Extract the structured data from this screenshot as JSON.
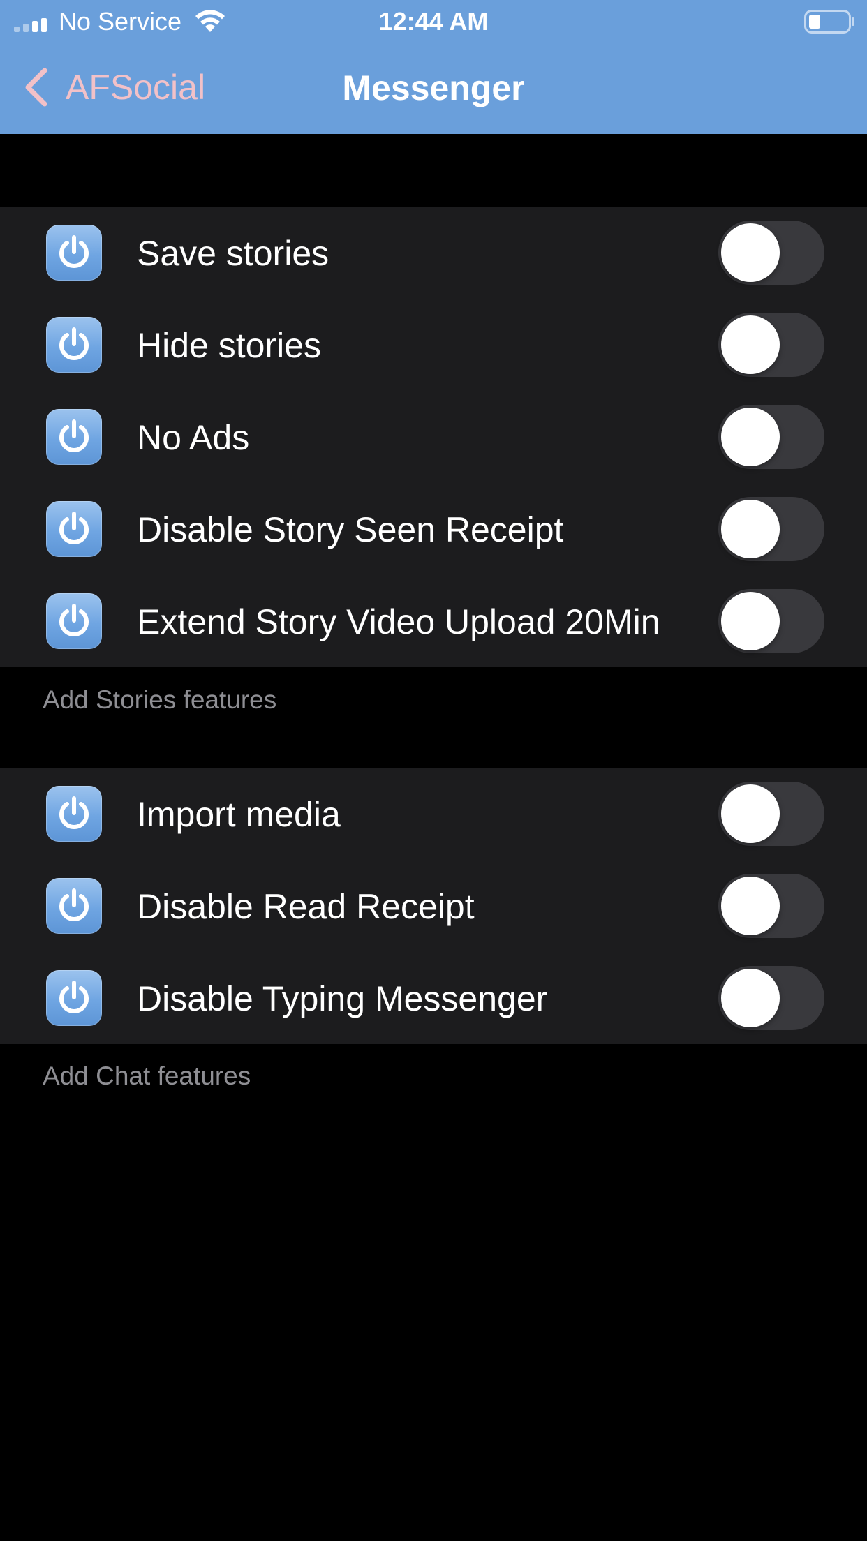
{
  "status_bar": {
    "carrier": "No Service",
    "time": "12:44 AM",
    "signal_icon": "signal-bars-icon",
    "wifi_icon": "wifi-icon",
    "battery_icon": "battery-icon"
  },
  "nav": {
    "back_label": "AFSocial",
    "title": "Messenger",
    "back_icon": "chevron-left-icon"
  },
  "colors": {
    "header_background": "#6a9fdb",
    "back_label": "#f2c1c8",
    "page_background": "#000000",
    "cell_background": "#1c1c1e",
    "toggle_off_track": "#39393d",
    "footer_text": "#8e8e93",
    "icon_tile": "#6fa5e2"
  },
  "sections": [
    {
      "footer": "Add Stories features",
      "rows": [
        {
          "label": "Save stories",
          "icon": "power-icon",
          "enabled": false
        },
        {
          "label": "Hide stories",
          "icon": "power-icon",
          "enabled": false
        },
        {
          "label": "No Ads",
          "icon": "power-icon",
          "enabled": false
        },
        {
          "label": "Disable Story Seen Receipt",
          "icon": "power-icon",
          "enabled": false
        },
        {
          "label": "Extend Story Video Upload 20Min",
          "icon": "power-icon",
          "enabled": false
        }
      ]
    },
    {
      "footer": "Add Chat features",
      "rows": [
        {
          "label": "Import media",
          "icon": "power-icon",
          "enabled": false
        },
        {
          "label": "Disable Read Receipt",
          "icon": "power-icon",
          "enabled": false
        },
        {
          "label": "Disable Typing Messenger",
          "icon": "power-icon",
          "enabled": false
        }
      ]
    }
  ]
}
